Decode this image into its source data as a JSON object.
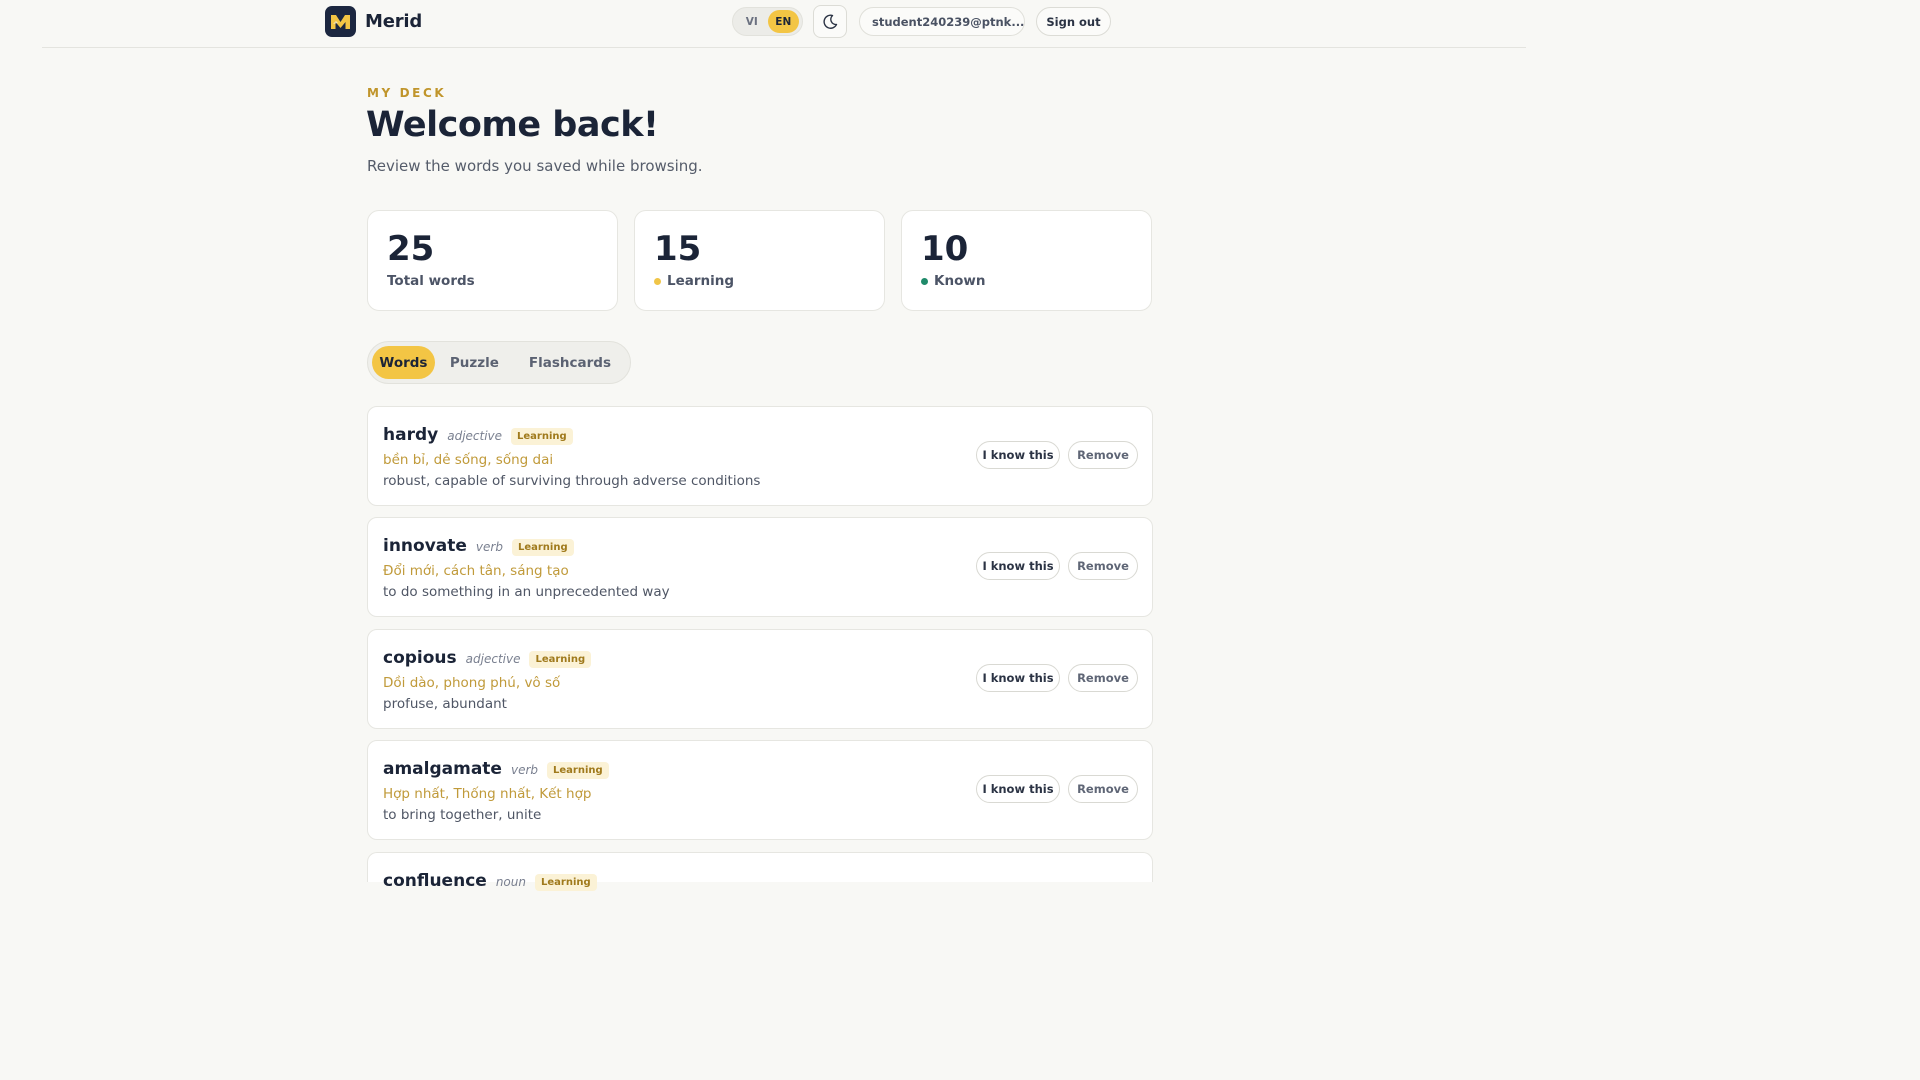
{
  "header": {
    "brand": "Merid",
    "lang_vi": "VI",
    "lang_en": "EN",
    "user_email": "student240239@ptnk....",
    "sign_out": "Sign out"
  },
  "page": {
    "eyebrow": "MY DECK",
    "title": "Welcome back!",
    "subtitle": "Review the words you saved while browsing."
  },
  "stats": [
    {
      "value": "25",
      "label": "Total words"
    },
    {
      "value": "15",
      "label": "Learning",
      "dot_color": "#f0c548"
    },
    {
      "value": "10",
      "label": "Known",
      "dot_color": "#1f8a6a"
    }
  ],
  "tabs": [
    "Words",
    "Puzzle",
    "Flashcards"
  ],
  "words": [
    {
      "word": "hardy",
      "pos": "adjective",
      "status": "Learning",
      "vi": "bền bỉ, dẻ sống, sống dai",
      "en": "robust, capable of surviving through adverse conditions",
      "know": "I know this",
      "remove": "Remove"
    },
    {
      "word": "innovate",
      "pos": "verb",
      "status": "Learning",
      "vi": "Đổi mới, cách tân, sáng tạo",
      "en": "to do something in an unprecedented way",
      "know": "I know this",
      "remove": "Remove"
    },
    {
      "word": "copious",
      "pos": "adjective",
      "status": "Learning",
      "vi": "Dồi dào, phong phú, vô số",
      "en": "profuse, abundant",
      "know": "I know this",
      "remove": "Remove"
    },
    {
      "word": "amalgamate",
      "pos": "verb",
      "status": "Learning",
      "vi": "Hợp nhất, Thống nhất, Kết hợp",
      "en": "to bring together, unite",
      "know": "I know this",
      "remove": "Remove"
    },
    {
      "word": "confluence",
      "pos": "noun",
      "status": "Learning"
    }
  ]
}
